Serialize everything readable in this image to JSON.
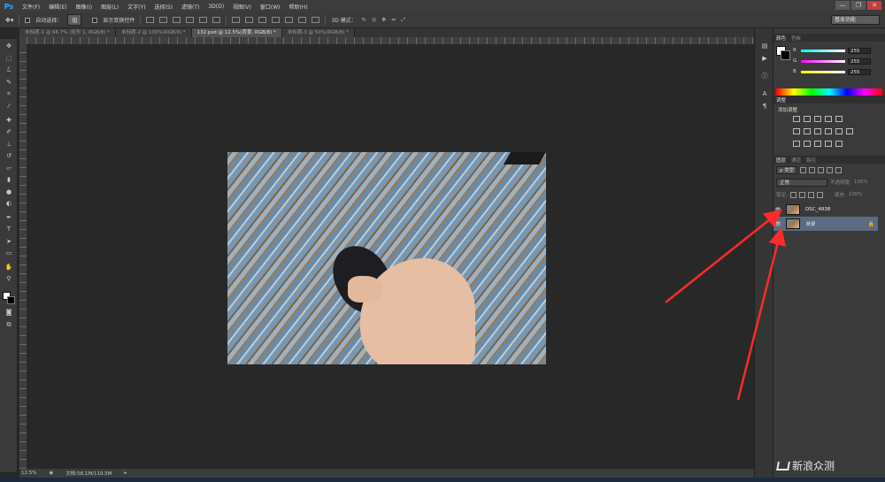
{
  "app": {
    "logo": "Ps",
    "menu": [
      "文件(F)",
      "编辑(E)",
      "图像(I)",
      "图层(L)",
      "文字(Y)",
      "选择(S)",
      "滤镜(T)",
      "3D(D)",
      "视图(V)",
      "窗口(W)",
      "帮助(H)"
    ],
    "window_controls": {
      "minimize": "—",
      "restore": "❐",
      "close": "✕"
    }
  },
  "options_bar": {
    "auto_select_label": "自动选择：",
    "auto_select_value": "组",
    "show_transform_label": "显示变换控件",
    "mode_3d_label": "3D 模式：",
    "workspace": "基本功能"
  },
  "tabs": [
    {
      "label": "未标题-1 @ 66.7% (矩形 1, RGB/8) *",
      "active": false
    },
    {
      "label": "未标题-2 @ 100%(RGB/8) *",
      "active": false
    },
    {
      "label": "132.psd @ 12.5%(背景, RGB/8) *",
      "active": true
    },
    {
      "label": "未标题-3 @ 50%(RGB/8) *",
      "active": false
    }
  ],
  "tools": [
    "move-icon",
    "marquee-icon",
    "lasso-icon",
    "quick-select-icon",
    "crop-icon",
    "eyedropper-icon",
    "healing-icon",
    "brush-icon",
    "stamp-icon",
    "history-brush-icon",
    "eraser-icon",
    "gradient-icon",
    "blur-icon",
    "dodge-icon",
    "pen-icon",
    "type-icon",
    "path-select-icon",
    "shape-icon",
    "hand-icon",
    "zoom-icon"
  ],
  "status": {
    "zoom": "12.5%",
    "doc": "文档:58.1M/119.5M"
  },
  "color_panel": {
    "tabs": [
      "颜色",
      "色板"
    ],
    "rows": [
      {
        "label": "R",
        "value": "255"
      },
      {
        "label": "G",
        "value": "255"
      },
      {
        "label": "B",
        "value": "255"
      }
    ],
    "bar_colors": [
      "#ff3030",
      "#30ff30",
      "#3030ff"
    ]
  },
  "adjustments_panel": {
    "tabs": [
      "调整"
    ],
    "title": "添加调整"
  },
  "layers_panel": {
    "tabs": [
      "图层",
      "通道",
      "路径"
    ],
    "filter": "ρ 类型",
    "blend_mode": "正常",
    "opacity_label": "不透明度:",
    "opacity_value": "100%",
    "lock_label": "锁定:",
    "fill_label": "填充:",
    "fill_value": "100%",
    "layers": [
      {
        "name": "DSC_4838",
        "selected": false,
        "italic": false
      },
      {
        "name": "背景",
        "selected": true,
        "italic": true
      }
    ]
  },
  "watermark": "新浪众测",
  "accent_color": "#ff2b2b"
}
